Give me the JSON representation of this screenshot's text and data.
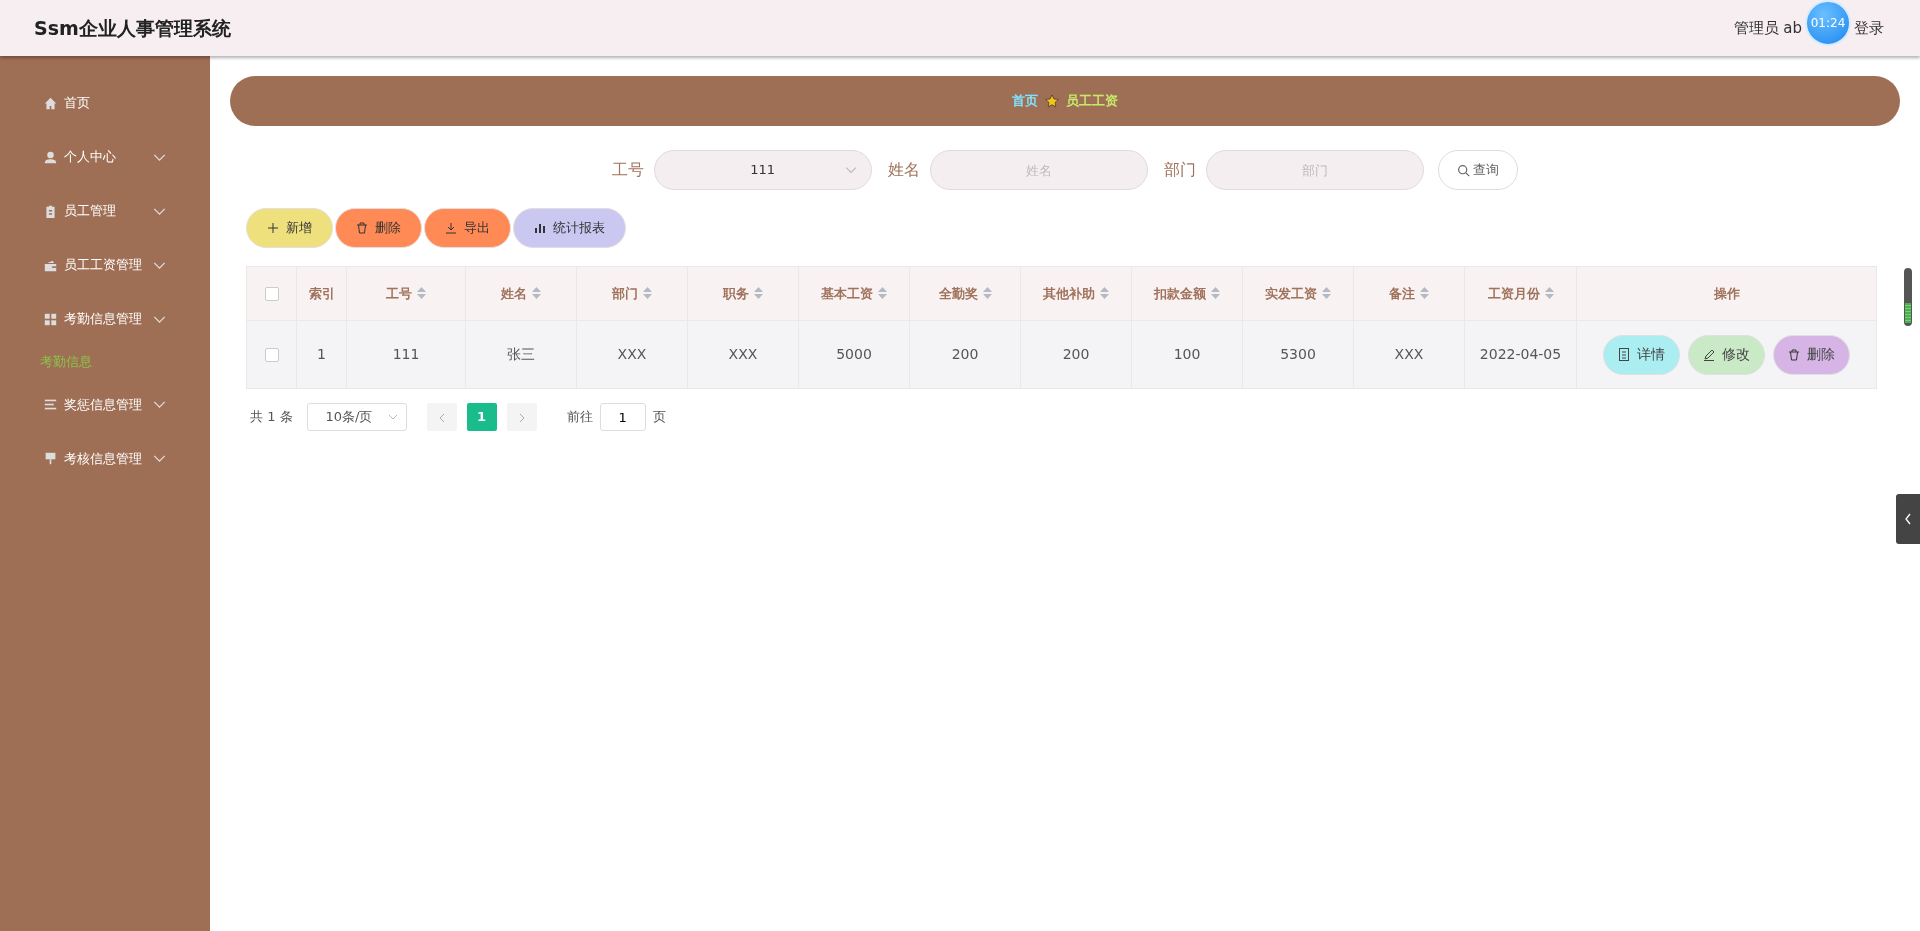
{
  "header": {
    "title": "Ssm企业人事管理系统",
    "user_text": "管理员 ab",
    "user_tail": "登录",
    "timer": "01:24"
  },
  "sidebar": {
    "items": [
      {
        "label": "首页",
        "kind": "link"
      },
      {
        "label": "个人中心",
        "kind": "submenu"
      },
      {
        "label": "员工管理",
        "kind": "submenu"
      },
      {
        "label": "员工工资管理",
        "kind": "submenu"
      },
      {
        "label": "考勤信息管理",
        "kind": "submenu",
        "children": [
          {
            "label": "考勤信息",
            "selected": true
          }
        ]
      },
      {
        "label": "奖惩信息管理",
        "kind": "submenu"
      },
      {
        "label": "考核信息管理",
        "kind": "submenu"
      }
    ]
  },
  "breadcrumb": [
    {
      "label": "首页",
      "kind": "home"
    },
    {
      "label": "员工工资",
      "kind": "current"
    }
  ],
  "search": {
    "fields": [
      {
        "label": "工号",
        "kind": "select",
        "value": "111"
      },
      {
        "label": "姓名",
        "kind": "input",
        "placeholder": "姓名"
      },
      {
        "label": "部门",
        "kind": "input",
        "placeholder": "部门"
      }
    ],
    "button": "查询"
  },
  "actions": [
    {
      "label": "新增",
      "kind": "add"
    },
    {
      "label": "删除",
      "kind": "delete"
    },
    {
      "label": "导出",
      "kind": "export"
    },
    {
      "label": "统计报表",
      "kind": "report"
    }
  ],
  "table": {
    "all_checked": false,
    "columns": [
      {
        "label": "索引",
        "sortable": false
      },
      {
        "label": "工号",
        "sortable": true
      },
      {
        "label": "姓名",
        "sortable": true
      },
      {
        "label": "部门",
        "sortable": true
      },
      {
        "label": "职务",
        "sortable": true
      },
      {
        "label": "基本工资",
        "sortable": true
      },
      {
        "label": "全勤奖",
        "sortable": true
      },
      {
        "label": "其他补助",
        "sortable": true
      },
      {
        "label": "扣款金额",
        "sortable": true
      },
      {
        "label": "实发工资",
        "sortable": true
      },
      {
        "label": "备注",
        "sortable": true
      },
      {
        "label": "工资月份",
        "sortable": true
      },
      {
        "label": "操作",
        "sortable": false
      }
    ],
    "rows": [
      {
        "checked": false,
        "cells": [
          "1",
          "111",
          "张三",
          "XXX",
          "XXX",
          "5000",
          "200",
          "200",
          "100",
          "5300",
          "XXX",
          "2022-04-05"
        ],
        "actions": [
          {
            "label": "详情",
            "kind": "detail"
          },
          {
            "label": "修改",
            "kind": "edit"
          },
          {
            "label": "删除",
            "kind": "delete"
          }
        ]
      }
    ]
  },
  "pagination": {
    "total": "共 1 条",
    "page_size": "10条/页",
    "pages": [
      {
        "label": "1",
        "selected": true
      }
    ],
    "goto_label": "前往",
    "goto_value": "1",
    "goto_suffix": "页"
  }
}
